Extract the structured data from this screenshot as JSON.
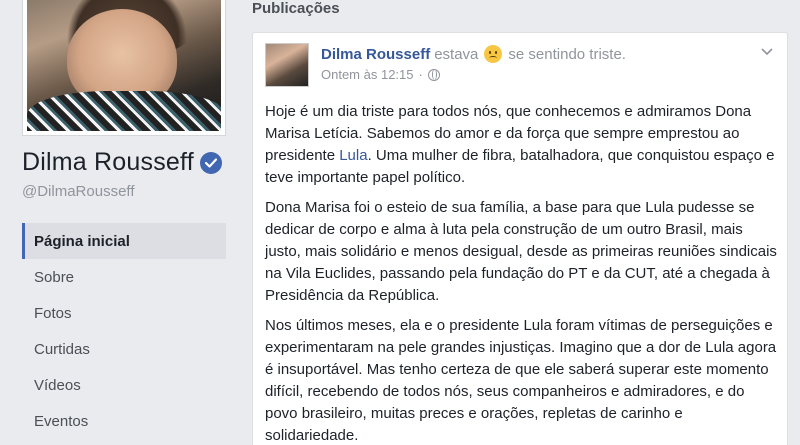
{
  "profile": {
    "name": "Dilma Rousseff",
    "handle": "@DilmaRousseff"
  },
  "nav": {
    "items": [
      {
        "label": "Página inicial",
        "active": true
      },
      {
        "label": "Sobre",
        "active": false
      },
      {
        "label": "Fotos",
        "active": false
      },
      {
        "label": "Curtidas",
        "active": false
      },
      {
        "label": "Vídeos",
        "active": false
      },
      {
        "label": "Eventos",
        "active": false
      }
    ]
  },
  "main": {
    "section_title": "Publicações"
  },
  "post": {
    "author": "Dilma Rousseff",
    "was": "estava",
    "feeling": "se sentindo triste.",
    "feeling_icon": "sad-face-icon",
    "timestamp": "Ontem às 12:15",
    "audience_icon": "globe-icon",
    "paragraphs": {
      "p1_before_link": "Hoje é um dia triste para todos nós, que conhecemos e admiramos Dona Marisa Letícia. Sabemos do amor e da força que sempre emprestou ao presidente ",
      "p1_link": "Lula",
      "p1_after_link": ". Uma mulher de fibra, batalhadora, que conquistou espaço e teve importante papel político.",
      "p2": "Dona Marisa foi o esteio de sua família, a base para que Lula pudesse se dedicar de corpo e alma à luta pela construção de um outro Brasil, mais justo, mais solidário e menos desigual, desde as primeiras reuniões sindicais na Vila Euclides, passando pela fundação do PT e da CUT, até a chegada à Presidência da República.",
      "p3": "Nos últimos meses, ela e o presidente Lula foram vítimas de perseguições e experimentaram na pele grandes injustiças. Imagino que a dor de Lula agora é insuportável. Mas tenho certeza de que ele saberá superar este momento difícil, recebendo de todos nós, seus companheiros e admiradores, e do povo brasileiro, muitas preces e orações, repletas de carinho e solidariedade."
    }
  },
  "colors": {
    "link": "#365899",
    "verified": "#4267b2",
    "background": "#e9ebee"
  }
}
